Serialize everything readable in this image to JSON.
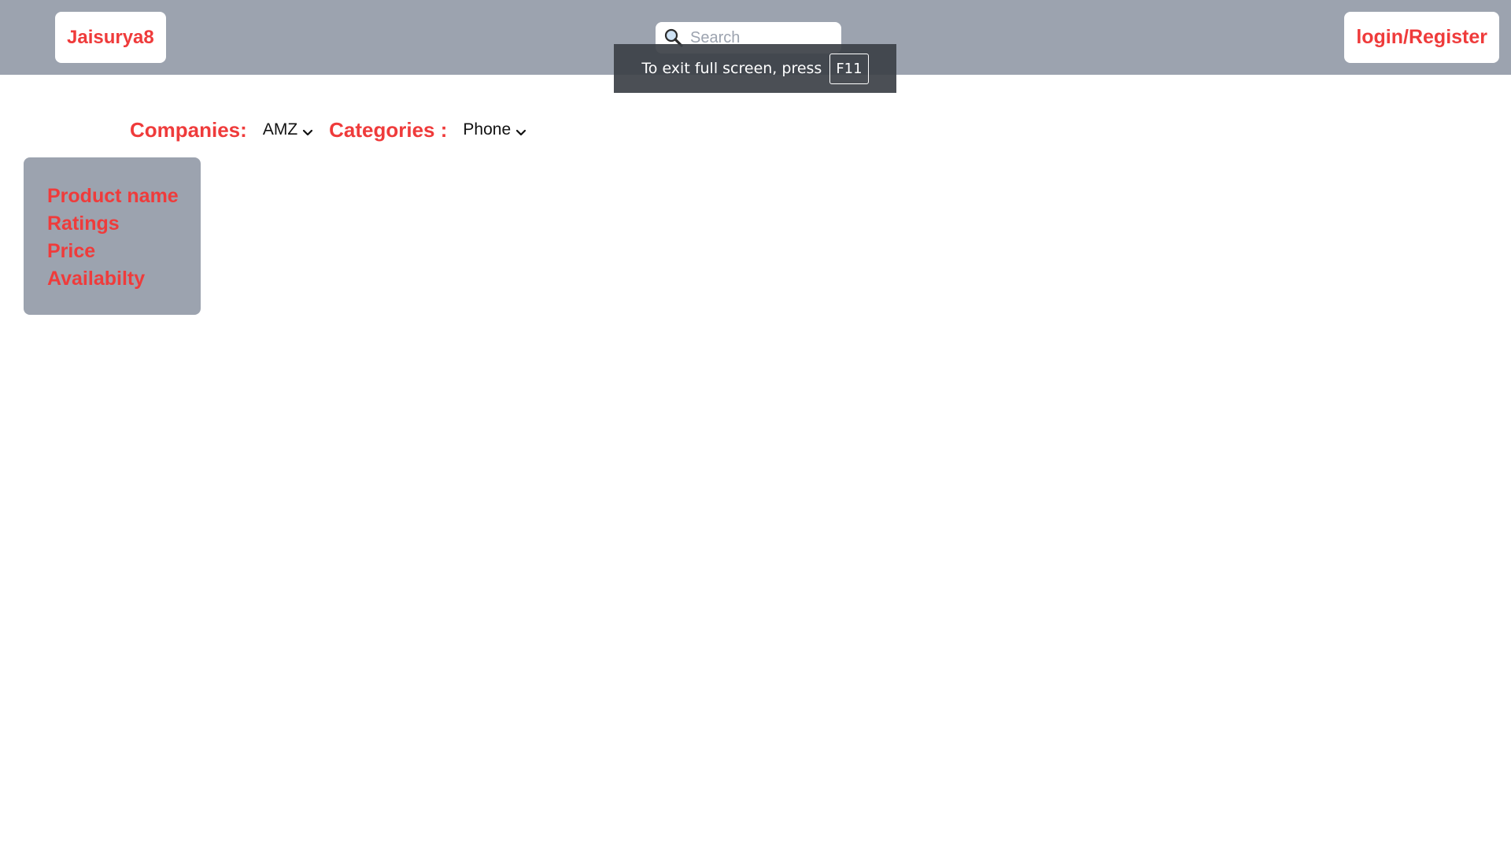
{
  "header": {
    "brand": "Jaisurya8",
    "search": {
      "placeholder": "Search",
      "value": ""
    },
    "auth_label": "login/Register"
  },
  "fullscreen_notice": {
    "text": "To exit full screen, press",
    "key": "F11"
  },
  "filters": {
    "companies_label": "Companies:",
    "company_selected": "AMZ",
    "categories_label": "Categories :",
    "category_selected": "Phone"
  },
  "product_card": {
    "lines": [
      "Product name",
      "Ratings",
      "Price",
      "Availabilty"
    ]
  },
  "colors": {
    "accent": "#ef3b3b",
    "bar": "#9ca3af",
    "background": "#ffffff"
  }
}
